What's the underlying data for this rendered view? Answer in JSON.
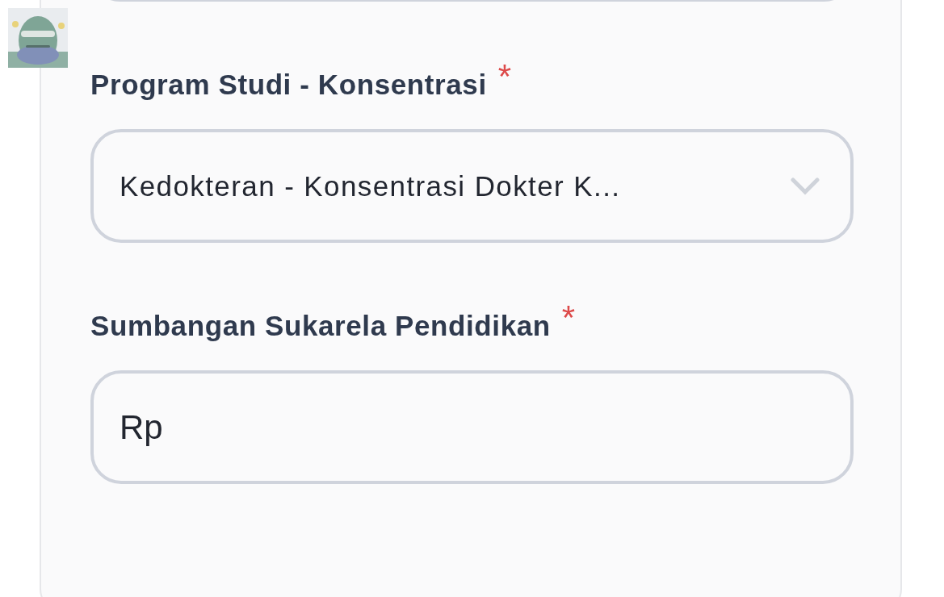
{
  "fields": [
    {
      "label": "Program Studi - Konsentrasi",
      "required_mark": "*",
      "kind": "select",
      "value": "Kedokteran - Konsentrasi Dokter K..."
    },
    {
      "label": "Sumbangan Sukarela Pendidikan",
      "required_mark": "*",
      "kind": "text",
      "value": "Rp"
    }
  ]
}
